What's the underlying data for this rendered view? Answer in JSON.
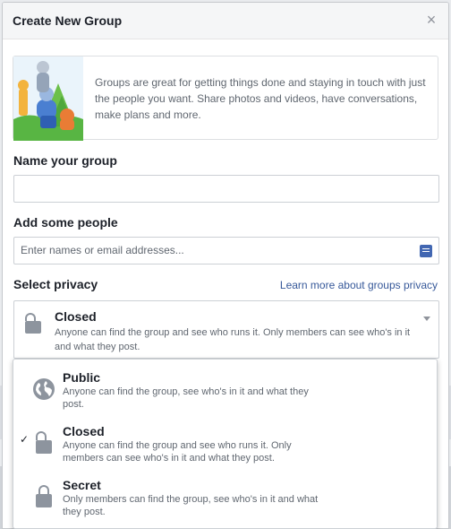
{
  "dialog": {
    "title": "Create New Group",
    "close_label": "×"
  },
  "intro": {
    "text": "Groups are great for getting things done and staying in touch with just the people you want. Share photos and videos, have conversations, make plans and more."
  },
  "name_group": {
    "label": "Name your group",
    "value": ""
  },
  "add_people": {
    "label": "Add some people",
    "placeholder": "Enter names or email addresses..."
  },
  "privacy": {
    "label": "Select privacy",
    "learn_more": "Learn more about groups privacy",
    "selected": {
      "title": "Closed",
      "description": "Anyone can find the group and see who runs it. Only members can see who's in it and what they post."
    },
    "options": [
      {
        "title": "Public",
        "description": "Anyone can find the group, see who's in it and what they post.",
        "icon": "globe-icon",
        "checked": false
      },
      {
        "title": "Closed",
        "description": "Anyone can find the group and see who runs it. Only members can see who's in it and what they post.",
        "icon": "lock-open-icon",
        "checked": true
      },
      {
        "title": "Secret",
        "description": "Only members can find the group, see who's in it and what they post.",
        "icon": "lock-icon",
        "checked": false
      }
    ],
    "check_glyph": "✓"
  },
  "colors": {
    "link": "#365899",
    "accent": "#4267b2",
    "icon_gray": "#8d949e"
  }
}
